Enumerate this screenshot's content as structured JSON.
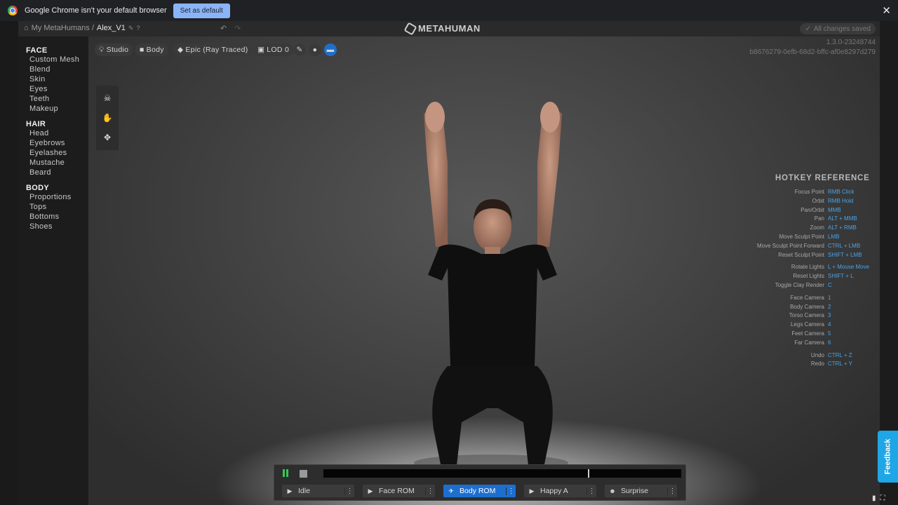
{
  "browser": {
    "notice": "Google Chrome isn't your default browser",
    "set_default": "Set as default",
    "close": "✕"
  },
  "topbar": {
    "breadcrumb_root": "My MetaHumans /",
    "breadcrumb_current": "Alex_V1",
    "logo": "METAHUMAN",
    "saved": "All changes saved"
  },
  "sidebar": {
    "sections": [
      {
        "title": "FACE",
        "items": [
          "Custom Mesh",
          "Blend",
          "Skin",
          "Eyes",
          "Teeth",
          "Makeup"
        ]
      },
      {
        "title": "HAIR",
        "items": [
          "Head",
          "Eyebrows",
          "Eyelashes",
          "Mustache",
          "Beard"
        ]
      },
      {
        "title": "BODY",
        "items": [
          "Proportions",
          "Tops",
          "Bottoms",
          "Shoes"
        ]
      }
    ]
  },
  "viewport_toolbar": {
    "lighting": "Studio",
    "camera": "Body",
    "quality": "Epic (Ray Traced)",
    "lod": "LOD 0"
  },
  "version": {
    "number": "1.3.0-23248744",
    "hash": "b8676279-0efb-68d2-bffc-af0e8297d279"
  },
  "hotkeys": {
    "title": "HOTKEY REFERENCE",
    "groups": [
      [
        {
          "action": "Focus Point",
          "key": "RMB Click"
        },
        {
          "action": "Orbit",
          "key": "RMB Hold"
        },
        {
          "action": "Pan/Orbit",
          "key": "MMB"
        },
        {
          "action": "Pan",
          "key": "ALT + MMB"
        },
        {
          "action": "Zoom",
          "key": "ALT + RMB"
        },
        {
          "action": "Move Sculpt Point",
          "key": "LMB"
        },
        {
          "action": "Move Sculpt Point Forward",
          "key": "CTRL + LMB"
        },
        {
          "action": "Reset Sculpt Point",
          "key": "SHIFT + LMB"
        }
      ],
      [
        {
          "action": "Rotate Lights",
          "key": "L + Mouse Move"
        },
        {
          "action": "Reset Lights",
          "key": "SHIFT + L"
        },
        {
          "action": "Toggle Clay Render",
          "key": "C"
        }
      ],
      [
        {
          "action": "Face Camera",
          "key": "1"
        },
        {
          "action": "Body Camera",
          "key": "2"
        },
        {
          "action": "Torso Camera",
          "key": "3"
        },
        {
          "action": "Legs Camera",
          "key": "4"
        },
        {
          "action": "Feet Camera",
          "key": "5"
        },
        {
          "action": "Far Camera",
          "key": "6"
        }
      ],
      [
        {
          "action": "Undo",
          "key": "CTRL + Z"
        },
        {
          "action": "Redo",
          "key": "CTRL + Y"
        }
      ]
    ]
  },
  "timeline": {
    "playhead_fraction": 0.74,
    "animations": [
      {
        "label": "Idle",
        "icon": "play-icon",
        "active": false
      },
      {
        "label": "Face ROM",
        "icon": "play-icon",
        "active": false
      },
      {
        "label": "Body ROM",
        "icon": "running-figure-icon",
        "active": true
      },
      {
        "label": "Happy A",
        "icon": "play-icon",
        "active": false
      },
      {
        "label": "Surprise",
        "icon": "face-icon",
        "active": false
      }
    ]
  },
  "feedback": "Feedback",
  "colors": {
    "accent_blue": "#1d6fcf",
    "hotkey_blue": "#4aa3e8",
    "play_green": "#34c759",
    "feedback_blue": "#1fa6e6"
  }
}
